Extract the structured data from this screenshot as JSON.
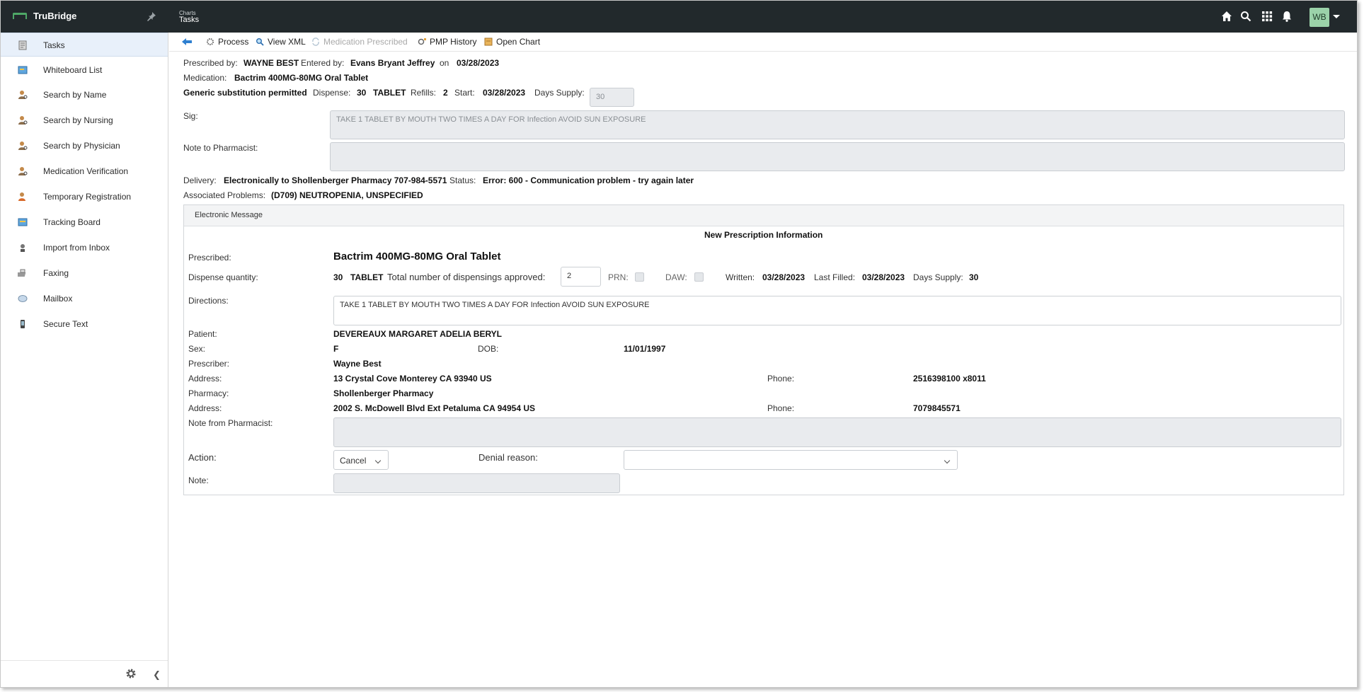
{
  "app": {
    "name": "TruBridge"
  },
  "header": {
    "breadcrumb": "Charts",
    "title": "Tasks",
    "avatar_initials": "WB"
  },
  "sidebar": {
    "items": [
      {
        "label": "Tasks",
        "icon": "tasks-icon"
      },
      {
        "label": "Whiteboard List",
        "icon": "whiteboard-icon"
      },
      {
        "label": "Search by Name",
        "icon": "person-search-icon"
      },
      {
        "label": "Search by Nursing",
        "icon": "person-search-icon"
      },
      {
        "label": "Search by Physician",
        "icon": "person-search-icon"
      },
      {
        "label": "Medication Verification",
        "icon": "person-search-icon"
      },
      {
        "label": "Temporary Registration",
        "icon": "person-add-icon"
      },
      {
        "label": "Tracking Board",
        "icon": "board-icon"
      },
      {
        "label": "Import from Inbox",
        "icon": "import-icon"
      },
      {
        "label": "Faxing",
        "icon": "fax-icon"
      },
      {
        "label": "Mailbox",
        "icon": "mail-icon"
      },
      {
        "label": "Secure Text",
        "icon": "phone-icon"
      }
    ]
  },
  "toolbar": {
    "process": "Process",
    "view_xml": "View XML",
    "medication_prescribed": "Medication Prescribed",
    "pmp_history": "PMP History",
    "open_chart": "Open Chart"
  },
  "rx": {
    "prescribed_by_label": "Prescribed by:",
    "prescribed_by": "WAYNE BEST",
    "entered_by_label": "Entered by:",
    "entered_by": "Evans Bryant Jeffrey",
    "on_label": "on",
    "entered_date": "03/28/2023",
    "medication_label": "Medication:",
    "medication": "Bactrim 400MG-80MG Oral Tablet",
    "generic": "Generic substitution permitted",
    "dispense_label": "Dispense:",
    "dispense_qty": "30",
    "dispense_unit": "TABLET",
    "refills_label": "Refills:",
    "refills": "2",
    "start_label": "Start:",
    "start": "03/28/2023",
    "days_supply_label": "Days Supply:",
    "days_supply": "30",
    "sig_label": "Sig:",
    "sig": "TAKE 1 TABLET BY MOUTH TWO TIMES A DAY FOR Infection AVOID SUN EXPOSURE",
    "note_label": "Note to Pharmacist:",
    "note": "",
    "delivery_label": "Delivery:",
    "delivery": "Electronically to Shollenberger Pharmacy 707-984-5571",
    "status_label": "Status:",
    "status": "Error: 600 - Communication problem - try again later",
    "problems_label": "Associated Problems:",
    "problems": "(D709) NEUTROPENIA, UNSPECIFIED"
  },
  "message": {
    "header": "Electronic Message",
    "title": "New Prescription Information",
    "prescribed_label": "Prescribed:",
    "prescribed": "Bactrim 400MG-80MG Oral Tablet",
    "dispense_qty_label": "Dispense quantity:",
    "dispense_qty": "30",
    "dispense_unit": "TABLET",
    "total_label": "Total number of dispensings approved:",
    "total": "2",
    "prn_label": "PRN:",
    "daw_label": "DAW:",
    "written_label": "Written:",
    "written": "03/28/2023",
    "last_filled_label": "Last Filled:",
    "last_filled": "03/28/2023",
    "days_supply_label": "Days Supply:",
    "days_supply": "30",
    "directions_label": "Directions:",
    "directions": "TAKE 1 TABLET BY MOUTH TWO TIMES A DAY FOR Infection AVOID SUN EXPOSURE",
    "patient_label": "Patient:",
    "patient": "DEVEREAUX MARGARET ADELIA BERYL",
    "sex_label": "Sex:",
    "sex": "F",
    "dob_label": "DOB:",
    "dob": "11/01/1997",
    "prescriber_label": "Prescriber:",
    "prescriber": "Wayne Best",
    "address_label": "Address:",
    "prescriber_address": "13 Crystal Cove Monterey CA 93940 US",
    "phone_label": "Phone:",
    "prescriber_phone": "2516398100 x8011",
    "pharmacy_label": "Pharmacy:",
    "pharmacy": "Shollenberger Pharmacy",
    "pharmacy_address_label": "Address:",
    "pharmacy_address": "2002 S. McDowell Blvd Ext Petaluma CA 94954 US",
    "pharmacy_phone_label": "Phone:",
    "pharmacy_phone": "7079845571",
    "note_from_pharmacist_label": "Note from Pharmacist:",
    "note_from_pharmacist": "",
    "action_label": "Action:",
    "action_value": "Cancel",
    "denial_label": "Denial reason:",
    "denial_value": "",
    "note_label": "Note:",
    "note": ""
  },
  "colors": {
    "topbar": "#22292c",
    "active_item": "#e8f0fa",
    "accent": "#3a7bd5",
    "brand_green": "#4ea866"
  }
}
